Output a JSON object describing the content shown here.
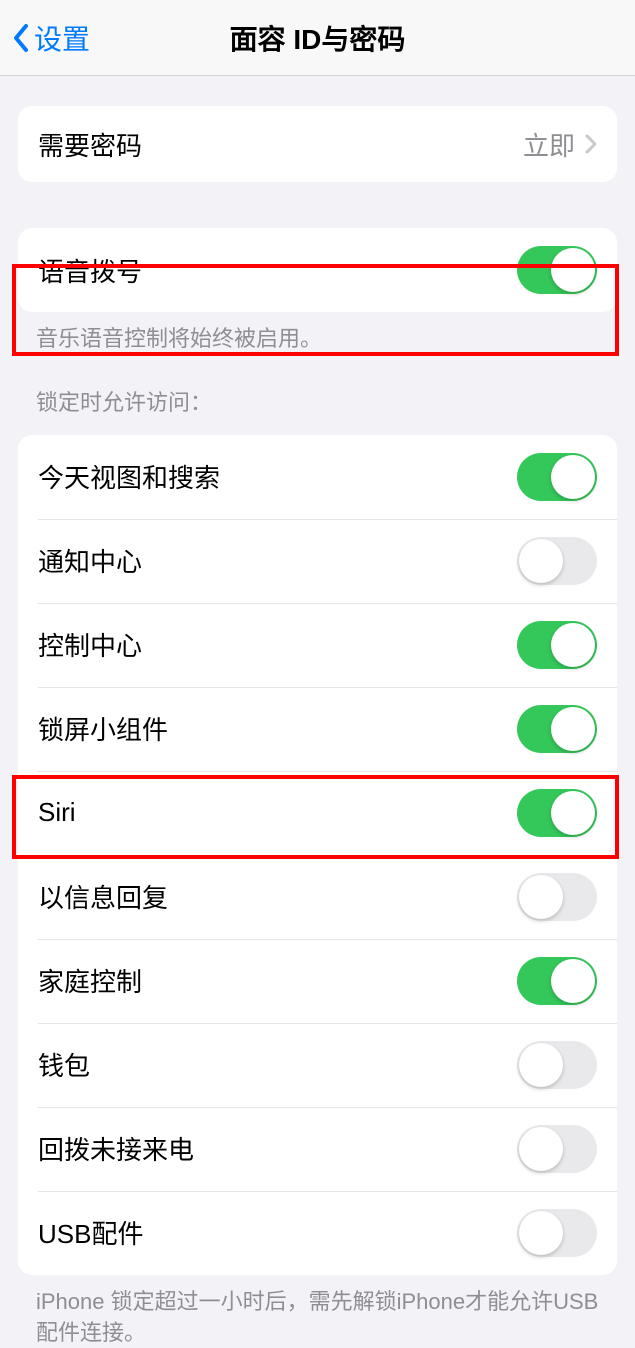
{
  "nav": {
    "back": "设置",
    "title": "面容 ID与密码"
  },
  "passcode": {
    "label": "需要密码",
    "value": "立即"
  },
  "voice": {
    "label": "语音拨号",
    "on": true,
    "footer": "音乐语音控制将始终被启用。"
  },
  "locked": {
    "header": "锁定时允许访问：",
    "items": [
      {
        "label": "今天视图和搜索",
        "on": true
      },
      {
        "label": "通知中心",
        "on": false
      },
      {
        "label": "控制中心",
        "on": true
      },
      {
        "label": "锁屏小组件",
        "on": true
      },
      {
        "label": "Siri",
        "on": true
      },
      {
        "label": "以信息回复",
        "on": false
      },
      {
        "label": "家庭控制",
        "on": true
      },
      {
        "label": "钱包",
        "on": false
      },
      {
        "label": "回拨未接来电",
        "on": false
      },
      {
        "label": "USB配件",
        "on": false
      }
    ],
    "footer": "iPhone 锁定超过一小时后，需先解锁iPhone才能允许USB 配件连接。"
  }
}
